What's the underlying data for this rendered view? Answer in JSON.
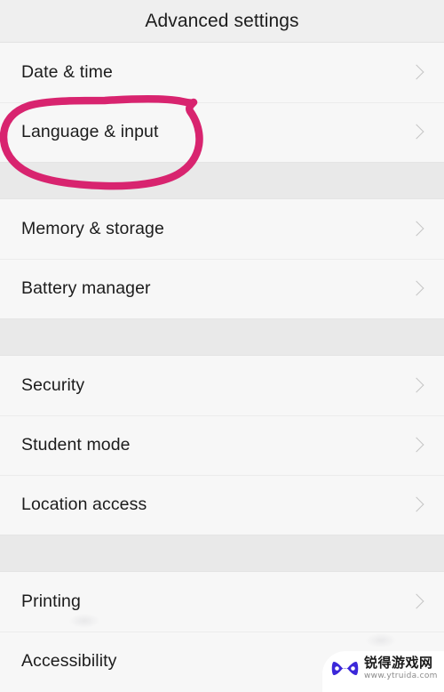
{
  "header": {
    "title": "Advanced settings"
  },
  "colors": {
    "annotation_pink": "#d8246f",
    "header_bg": "#efefef",
    "list_bg": "#f7f7f7",
    "band_bg": "#e9e9e9",
    "text": "#1c1c1c",
    "chevron": "#bdbdbd",
    "watermark_logo": "#3b27d9"
  },
  "list": {
    "sections": [
      {
        "rows": [
          {
            "label": "Date & time",
            "chevron": "chevron-right-icon",
            "annotated": false
          },
          {
            "label": "Language & input",
            "chevron": "chevron-right-icon",
            "annotated": true
          }
        ]
      },
      {
        "rows": [
          {
            "label": "Memory & storage",
            "chevron": "chevron-right-icon",
            "annotated": false
          },
          {
            "label": "Battery manager",
            "chevron": "chevron-right-icon",
            "annotated": false
          }
        ]
      },
      {
        "rows": [
          {
            "label": "Security",
            "chevron": "chevron-right-icon",
            "annotated": false
          },
          {
            "label": "Student mode",
            "chevron": "chevron-right-icon",
            "annotated": false
          },
          {
            "label": "Location access",
            "chevron": "chevron-right-icon",
            "annotated": false
          }
        ]
      },
      {
        "rows": [
          {
            "label": "Printing",
            "chevron": "chevron-right-icon",
            "annotated": false
          },
          {
            "label": "Accessibility",
            "chevron": "chevron-right-icon",
            "annotated": false
          }
        ]
      }
    ]
  },
  "annotation": {
    "type": "hand-drawn-ellipse",
    "target": "Language & input",
    "color": "#d8246f"
  },
  "watermark": {
    "site_name": "锐得游戏网",
    "url": "www.ytruida.com",
    "icon": "gamepad-icon"
  }
}
